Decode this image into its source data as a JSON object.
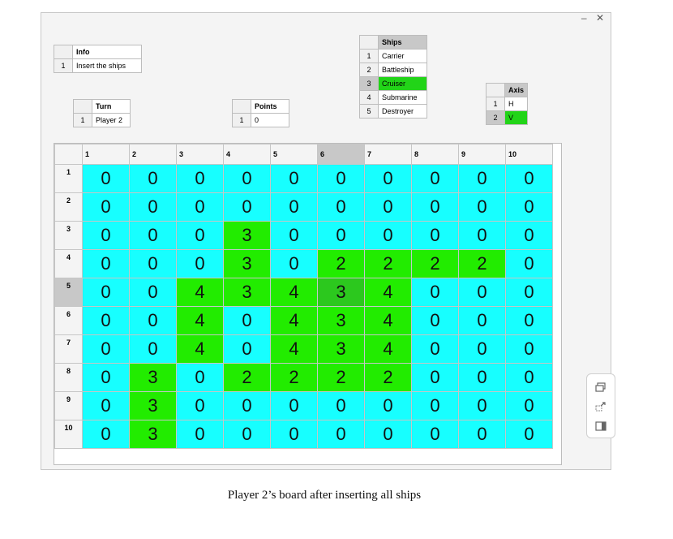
{
  "window_controls": {
    "minimize": "–",
    "close": "✕"
  },
  "info": {
    "header": "Info",
    "rows": [
      {
        "index": "1",
        "text": "Insert the ships"
      }
    ]
  },
  "turn": {
    "header": "Turn",
    "rows": [
      {
        "index": "1",
        "text": "Player 2"
      }
    ]
  },
  "points": {
    "header": "Points",
    "rows": [
      {
        "index": "1",
        "text": "0"
      }
    ]
  },
  "ships": {
    "header": "Ships",
    "rows": [
      {
        "index": "1",
        "text": "Carrier"
      },
      {
        "index": "2",
        "text": "Battleship"
      },
      {
        "index": "3",
        "text": "Cruiser",
        "selected": true
      },
      {
        "index": "4",
        "text": "Submarine"
      },
      {
        "index": "5",
        "text": "Destroyer"
      }
    ]
  },
  "axis": {
    "header": "Axis",
    "rows": [
      {
        "index": "1",
        "text": "H"
      },
      {
        "index": "2",
        "text": "V",
        "selected": true
      }
    ]
  },
  "board": {
    "columns": [
      "1",
      "2",
      "3",
      "4",
      "5",
      "6",
      "7",
      "8",
      "9",
      "10"
    ],
    "rows": [
      "1",
      "2",
      "3",
      "4",
      "5",
      "6",
      "7",
      "8",
      "9",
      "10"
    ],
    "selected_row": "5",
    "selected_column": "6",
    "selected_cell": {
      "row": 5,
      "col": 6
    },
    "cells": [
      [
        0,
        0,
        0,
        0,
        0,
        0,
        0,
        0,
        0,
        0
      ],
      [
        0,
        0,
        0,
        0,
        0,
        0,
        0,
        0,
        0,
        0
      ],
      [
        0,
        0,
        0,
        3,
        0,
        0,
        0,
        0,
        0,
        0
      ],
      [
        0,
        0,
        0,
        3,
        0,
        2,
        2,
        2,
        2,
        0
      ],
      [
        0,
        0,
        4,
        3,
        4,
        3,
        4,
        0,
        0,
        0
      ],
      [
        0,
        0,
        4,
        0,
        4,
        3,
        4,
        0,
        0,
        0
      ],
      [
        0,
        0,
        4,
        0,
        4,
        3,
        4,
        0,
        0,
        0
      ],
      [
        0,
        3,
        0,
        2,
        2,
        2,
        2,
        0,
        0,
        0
      ],
      [
        0,
        3,
        0,
        0,
        0,
        0,
        0,
        0,
        0,
        0
      ],
      [
        0,
        3,
        0,
        0,
        0,
        0,
        0,
        0,
        0,
        0
      ]
    ],
    "colors": {
      "water": "#17ffff",
      "ship": "#22ec00",
      "selected": "#2cc81e"
    }
  },
  "side_tools": [
    "window-restore-icon",
    "resize-icon",
    "panel-icon"
  ],
  "caption": "Player 2’s board after inserting all ships"
}
